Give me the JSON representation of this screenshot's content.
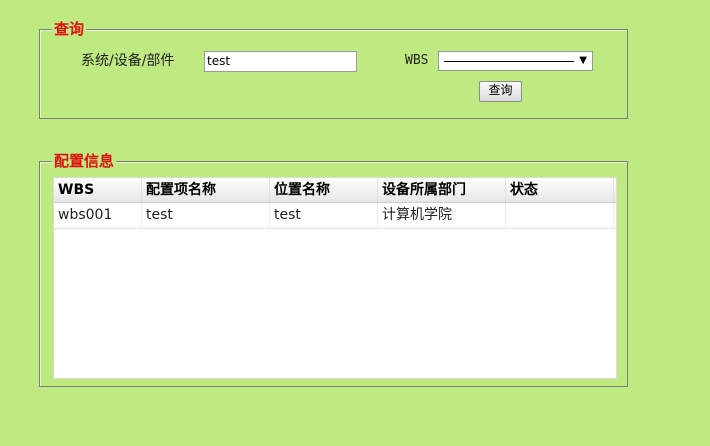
{
  "query_section": {
    "legend": "查询",
    "system_label": "系统/设备/部件",
    "system_value": "test",
    "wbs_label": "WBS",
    "wbs_selected": "",
    "query_button": "查询"
  },
  "config_section": {
    "legend": "配置信息",
    "columns": [
      "WBS",
      "配置项名称",
      "位置名称",
      "设备所属部门",
      "状态"
    ],
    "rows": [
      [
        "wbs001",
        "test",
        "test",
        "计算机学院",
        ""
      ]
    ]
  },
  "colors": {
    "background": "#bfe981",
    "legend": "#e01010"
  },
  "icons": {
    "select_arrow": "chevron-down-icon"
  }
}
